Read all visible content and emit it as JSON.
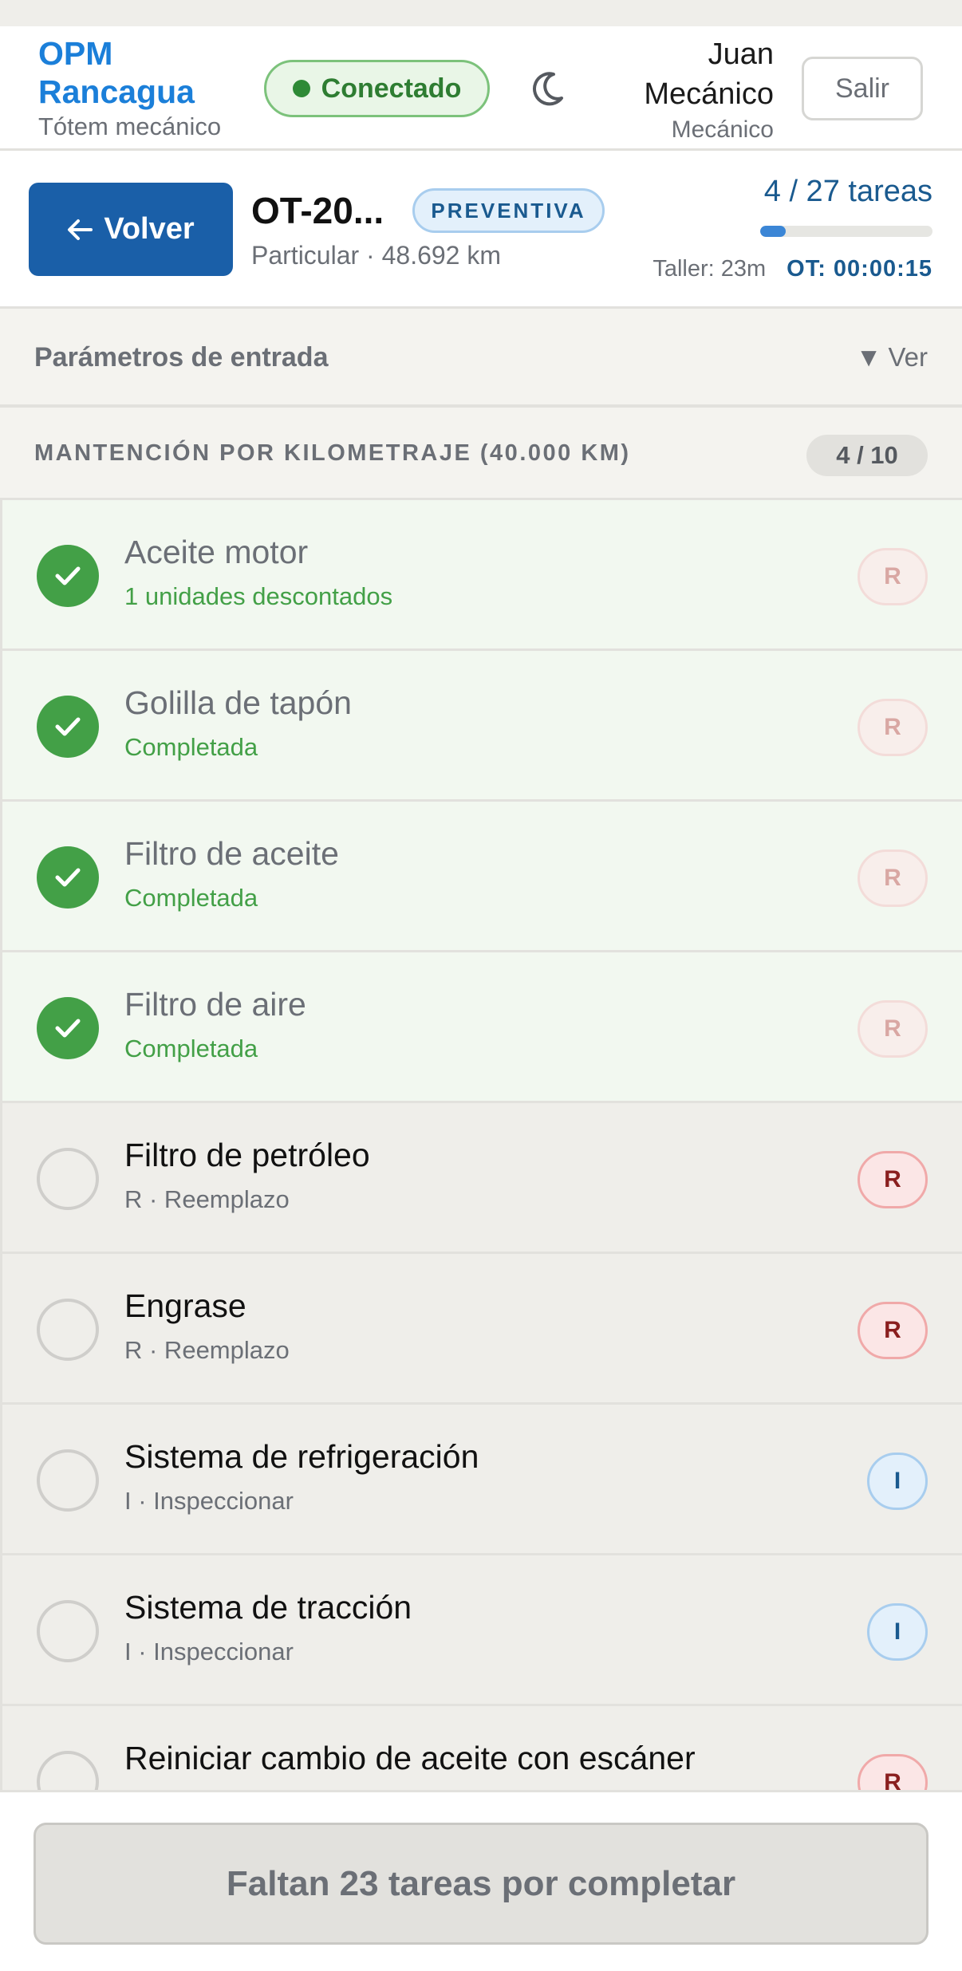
{
  "header": {
    "brand_line1": "OPM",
    "brand_line2": "Rancagua",
    "brand_sub": "Tótem mecánico",
    "status": "Conectado",
    "user_first": "Juan",
    "user_last": "Mecánico",
    "user_role": "Mecánico",
    "logout": "Salir",
    "theme_icon": "moon-icon",
    "status_color": "#2e8a36"
  },
  "order": {
    "back": "Volver",
    "back_icon": "arrow-left-icon",
    "id": "OT-20...",
    "type": "PREVENTIVA",
    "subtitle": "Particular · 48.692 km",
    "progress_label": "4 / 27 tareas",
    "progress_fraction": 0.148,
    "taller": "Taller: 23m",
    "ot_timer": "OT: 00:00:15"
  },
  "params": {
    "title": "Parámetros de entrada",
    "toggle_icon": "▼",
    "toggle": "Ver"
  },
  "section": {
    "title": "MANTENCIÓN POR KILOMETRAJE (40.000 KM)",
    "count": "4 / 10"
  },
  "tasks": [
    {
      "title": "Aceite motor",
      "sub": "1 unidades descontados",
      "code": "R",
      "done": true
    },
    {
      "title": "Golilla de tapón",
      "sub": "Completada",
      "code": "R",
      "done": true
    },
    {
      "title": "Filtro de aceite",
      "sub": "Completada",
      "code": "R",
      "done": true
    },
    {
      "title": "Filtro de aire",
      "sub": "Completada",
      "code": "R",
      "done": true
    },
    {
      "title": "Filtro de petróleo",
      "sub": "R · Reemplazo",
      "code": "R",
      "done": false
    },
    {
      "title": "Engrase",
      "sub": "R · Reemplazo",
      "code": "R",
      "done": false
    },
    {
      "title": "Sistema de refrigeración",
      "sub": "I · Inspeccionar",
      "code": "I",
      "done": false
    },
    {
      "title": "Sistema de tracción",
      "sub": "I · Inspeccionar",
      "code": "I",
      "done": false
    },
    {
      "title": "Reiniciar cambio de aceite con escáner",
      "sub": "",
      "code": "R",
      "done": false
    }
  ],
  "footer": {
    "button": "Faltan 23 tareas por completar"
  }
}
